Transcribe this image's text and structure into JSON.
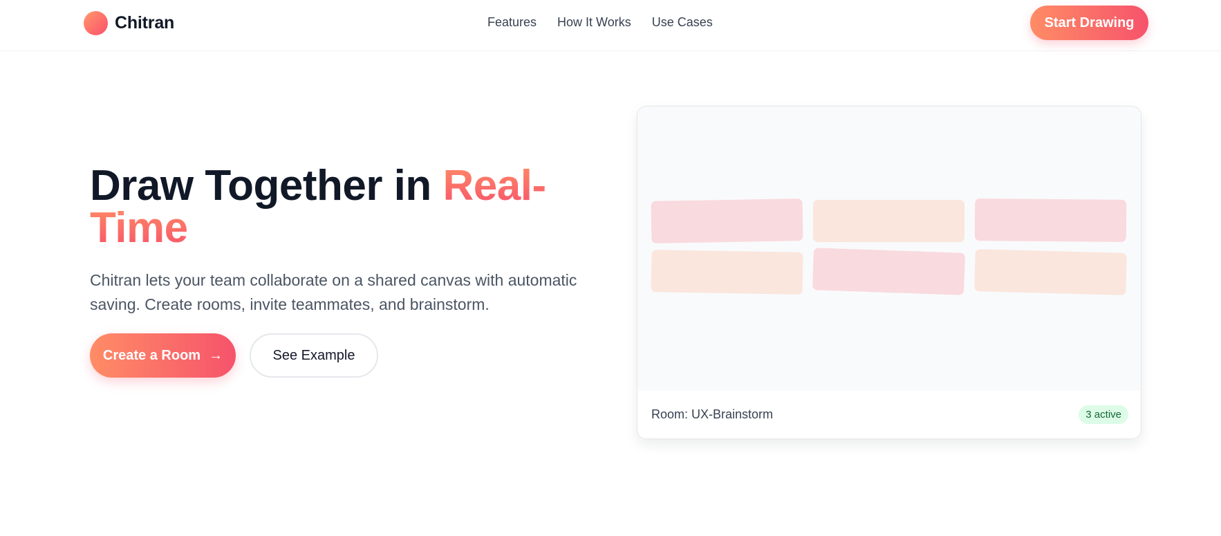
{
  "nav": {
    "logo_text": "Chitran",
    "links": [
      "Features",
      "How It Works",
      "Use Cases"
    ],
    "cta_label": "Start Drawing"
  },
  "hero": {
    "title_main": "Draw Together in ",
    "title_accent": "Real-Time",
    "subtitle": "Chitran lets your team collaborate on a shared canvas with automatic saving. Create rooms, invite teammates, and brainstorm.",
    "primary_button": "Create a Room",
    "secondary_button": "See Example"
  },
  "preview": {
    "room_label": "Room: UX-Brainstorm",
    "active_badge": "3 active"
  },
  "colors": {
    "accent_start": "#ff8c66",
    "accent_end": "#f6536b",
    "sticky_pink": "#f9dade",
    "sticky_peach": "#fae6dd",
    "badge_bg": "#dcfce7",
    "badge_text": "#166534"
  },
  "icons": {
    "logo": "gradient-circle-icon",
    "primary_button": "arrow-right-icon"
  }
}
